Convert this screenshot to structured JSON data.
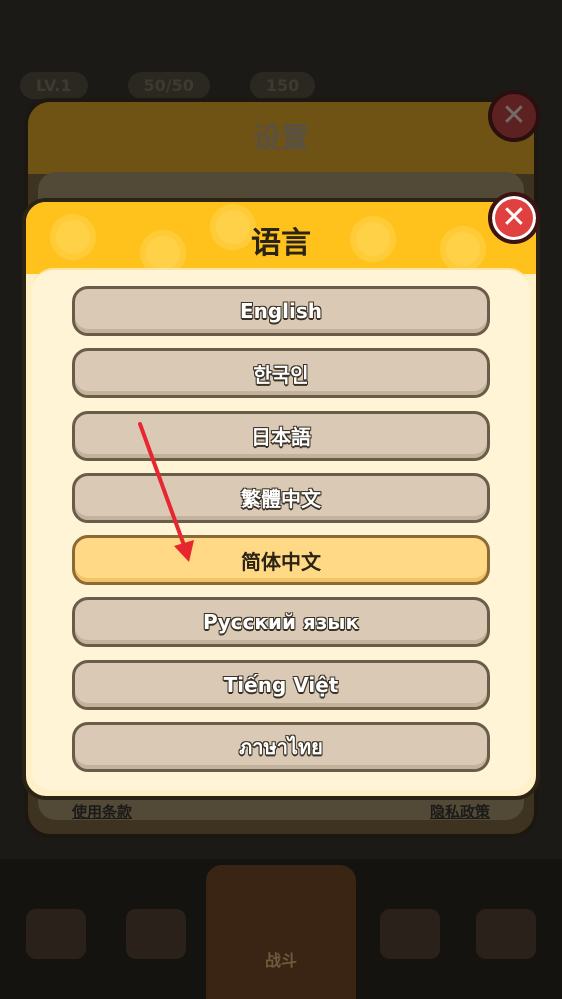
{
  "settings": {
    "title": "设置",
    "terms_link": "使用条款",
    "privacy_link": "隐私政策",
    "close_icon": "close-icon"
  },
  "background": {
    "hud_level": "LV.1",
    "hud_value1": "50/50",
    "hud_value2": "150",
    "bottom_tab_label": "战斗"
  },
  "language": {
    "title": "语言",
    "close_icon": "close-icon",
    "selected": "简体中文",
    "options": [
      "English",
      "한국인",
      "日本語",
      "繁體中文",
      "简体中文",
      "Русский язык",
      "Tiếng Việt",
      "ภาษาไทย"
    ]
  },
  "colors": {
    "header_yellow": "#ffc21d",
    "close_red": "#e0403f",
    "selected_option": "#ffd985",
    "annotation_arrow": "#e8262f"
  }
}
